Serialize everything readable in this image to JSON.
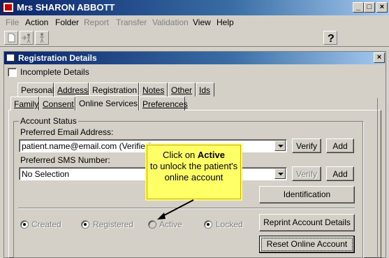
{
  "window": {
    "title": "Mrs SHARON ABBOTT",
    "min": "_",
    "max": "□",
    "close": "×"
  },
  "menu": [
    {
      "label": "File",
      "enabled": false
    },
    {
      "label": "Action",
      "enabled": true
    },
    {
      "label": "Folder",
      "enabled": true
    },
    {
      "label": "Report",
      "enabled": false
    },
    {
      "label": "Transfer",
      "enabled": false
    },
    {
      "label": "Validation",
      "enabled": false
    },
    {
      "label": "View",
      "enabled": true
    },
    {
      "label": "Help",
      "enabled": true
    }
  ],
  "panel": {
    "title": "Registration Details",
    "close": "×"
  },
  "incomplete_details_label": "Incomplete Details",
  "tabs_row1": [
    "Personal",
    "Address",
    "Registration",
    "Notes",
    "Other",
    "Ids"
  ],
  "tabs_row2": [
    "Family",
    "Consent",
    "Online Services",
    "Preferences"
  ],
  "active_tab": "Online Services",
  "account": {
    "group_label": "Account Status",
    "email_label": "Preferred Email Address:",
    "email_value": "patient.name@email.com (Verified)",
    "sms_label": "Preferred SMS Number:",
    "sms_value": "No Selection",
    "verify_label": "Verify",
    "add_label": "Add",
    "identification_label": "Identification",
    "reprint_label": "Reprint Account Details",
    "reset_label": "Reset Online Account",
    "statuses": [
      {
        "label": "Created",
        "checked": true
      },
      {
        "label": "Registered",
        "checked": true
      },
      {
        "label": "Active",
        "checked": false
      },
      {
        "label": "Locked",
        "checked": true
      }
    ]
  },
  "callout": {
    "pre": "Click on",
    "bold": "Active",
    "post": "to unlock the patient's online account"
  },
  "colors": {
    "window_bg": "#d4d0c8",
    "titlebar": "#0a246a",
    "callout_bg": "#ffff66"
  }
}
